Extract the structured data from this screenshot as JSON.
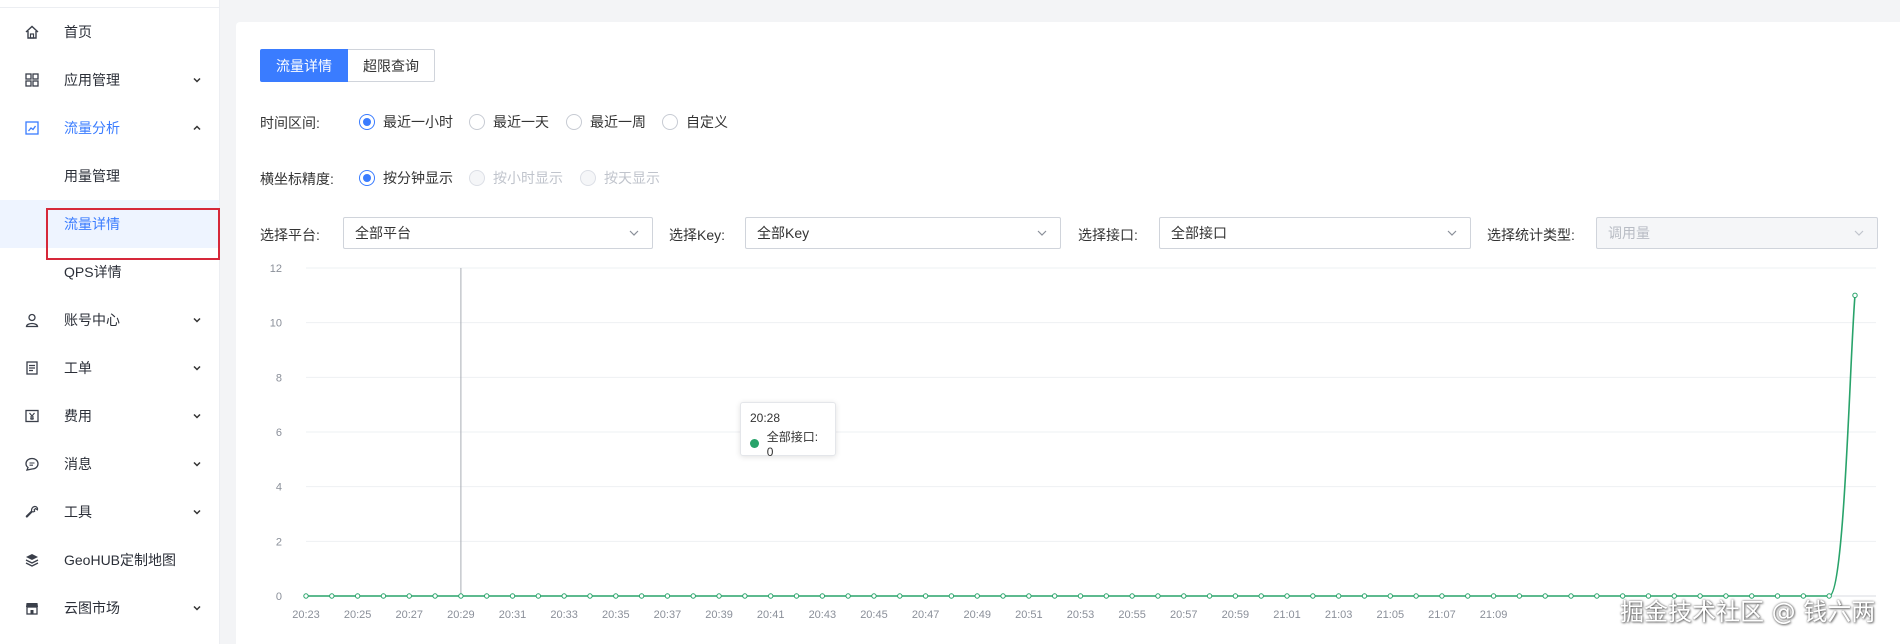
{
  "sidebar": {
    "items": [
      {
        "label": "首页",
        "icon": "home-icon",
        "expandable": false
      },
      {
        "label": "应用管理",
        "icon": "grid-icon",
        "expandable": true
      },
      {
        "label": "流量分析",
        "icon": "chart-icon",
        "expandable": true,
        "expanded": true
      },
      {
        "label": "账号中心",
        "icon": "user-icon",
        "expandable": true
      },
      {
        "label": "工单",
        "icon": "ticket-icon",
        "expandable": true
      },
      {
        "label": "费用",
        "icon": "yen-icon",
        "expandable": true
      },
      {
        "label": "消息",
        "icon": "message-icon",
        "expandable": true
      },
      {
        "label": "工具",
        "icon": "wrench-icon",
        "expandable": true
      },
      {
        "label": "GeoHUB定制地图",
        "icon": "layers-icon",
        "expandable": false
      },
      {
        "label": "云图市场",
        "icon": "store-icon",
        "expandable": true
      }
    ],
    "subitems": [
      {
        "label": "用量管理"
      },
      {
        "label": "流量详情",
        "selected": true
      },
      {
        "label": "QPS详情"
      }
    ]
  },
  "tabs": [
    {
      "label": "流量详情",
      "active": true
    },
    {
      "label": "超限查询",
      "active": false
    }
  ],
  "time_range": {
    "label": "时间区间:",
    "options": [
      "最近一小时",
      "最近一天",
      "最近一周",
      "自定义"
    ],
    "selected": "最近一小时"
  },
  "precision": {
    "label": "横坐标精度:",
    "options": [
      "按分钟显示",
      "按小时显示",
      "按天显示"
    ],
    "selected": "按分钟显示",
    "disabled": [
      "按小时显示",
      "按天显示"
    ]
  },
  "filters": {
    "platform_label": "选择平台:",
    "platform_value": "全部平台",
    "key_label": "选择Key:",
    "key_value": "全部Key",
    "api_label": "选择接口:",
    "api_value": "全部接口",
    "stat_type_label": "选择统计类型:",
    "stat_type_value": "调用量"
  },
  "tooltip": {
    "time": "20:28",
    "series_label": "全部接口: 0"
  },
  "watermark": "掘金技术社区 @ 钱六两",
  "colors": {
    "accent": "#3a7cff",
    "series": "#28a36a",
    "highlight": "#d6283a"
  },
  "chart_data": {
    "type": "line",
    "x": [
      "20:23",
      "20:24",
      "20:25",
      "20:26",
      "20:27",
      "20:28",
      "20:29",
      "20:30",
      "20:31",
      "20:32",
      "20:33",
      "20:34",
      "20:35",
      "20:36",
      "20:37",
      "20:38",
      "20:39",
      "20:40",
      "20:41",
      "20:42",
      "20:43",
      "20:44",
      "20:45",
      "20:46",
      "20:47",
      "20:48",
      "20:49",
      "20:50",
      "20:51",
      "20:52",
      "20:53",
      "20:54",
      "20:55",
      "20:56",
      "20:57",
      "20:58",
      "20:59",
      "21:00",
      "21:01",
      "21:02",
      "21:03",
      "21:04",
      "21:05",
      "21:06",
      "21:07",
      "21:08",
      "21:09",
      "21:10",
      "21:11",
      "21:12",
      "21:13",
      "21:14",
      "21:15",
      "21:16",
      "21:17",
      "21:18",
      "21:19",
      "21:20",
      "21:21",
      "21:22",
      "21:23"
    ],
    "x_tick_labels": [
      "20:23",
      "20:25",
      "20:27",
      "20:29",
      "20:31",
      "20:33",
      "20:35",
      "20:37",
      "20:39",
      "20:41",
      "20:43",
      "20:45",
      "20:47",
      "20:49",
      "20:51",
      "20:53",
      "20:55",
      "20:57",
      "20:59",
      "21:01",
      "21:03",
      "21:05",
      "21:07",
      "21:09"
    ],
    "series": [
      {
        "name": "全部接口",
        "values": [
          0,
          0,
          0,
          0,
          0,
          0,
          0,
          0,
          0,
          0,
          0,
          0,
          0,
          0,
          0,
          0,
          0,
          0,
          0,
          0,
          0,
          0,
          0,
          0,
          0,
          0,
          0,
          0,
          0,
          0,
          0,
          0,
          0,
          0,
          0,
          0,
          0,
          0,
          0,
          0,
          0,
          0,
          0,
          0,
          0,
          0,
          0,
          0,
          0,
          0,
          0,
          0,
          0,
          0,
          0,
          0,
          0,
          0,
          0,
          0,
          11
        ]
      }
    ],
    "ylim": [
      0,
      12
    ],
    "y_ticks": [
      0,
      2,
      4,
      6,
      8,
      10,
      12
    ],
    "grid": true,
    "hover_index": 5
  }
}
